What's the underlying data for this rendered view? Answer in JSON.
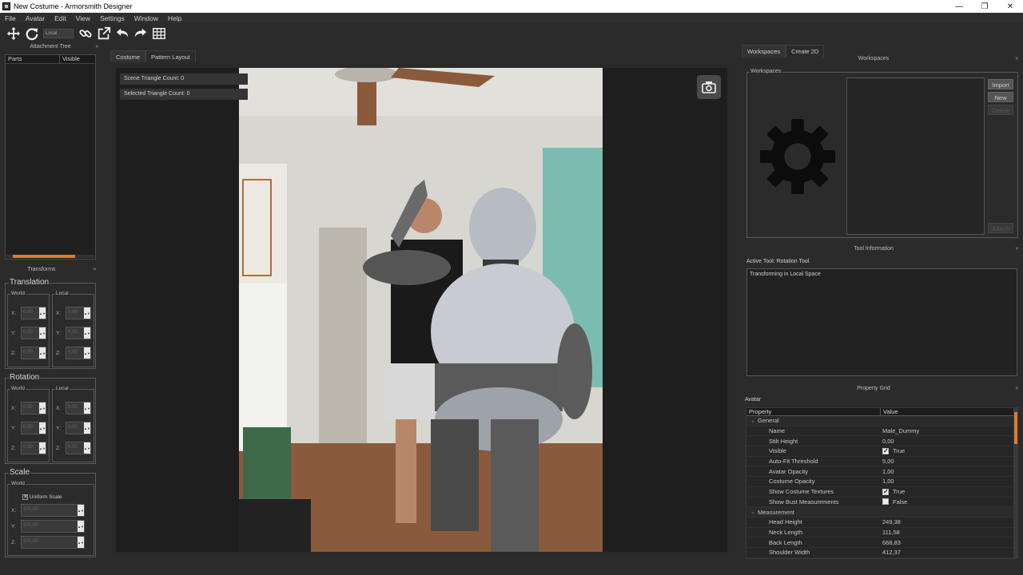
{
  "window": {
    "title": "New Costume - Armorsmith Designer",
    "minimize": "—",
    "restore": "❐",
    "close": "✕"
  },
  "menu": [
    "File",
    "Avatar",
    "Edit",
    "View",
    "Settings",
    "Window",
    "Help"
  ],
  "toolbar": {
    "space_mode": "Local",
    "icons": [
      "move-icon",
      "rotate-icon",
      "link-icon",
      "external-icon",
      "undo-icon",
      "redo-icon",
      "grid-icon"
    ]
  },
  "attachment_tree": {
    "title": "Attachment Tree",
    "columns": [
      "Parts",
      "Visible"
    ]
  },
  "transforms": {
    "title": "Transforms",
    "translation": {
      "label": "Translation",
      "world": "World",
      "local": "Local"
    },
    "rotation": {
      "label": "Rotation",
      "world": "World",
      "local": "Local"
    },
    "scale": {
      "label": "Scale",
      "world": "World",
      "uniform": "Uniform Scale",
      "uniform_checked": true,
      "x": "100,00",
      "y": "100,00",
      "z": "100,00"
    },
    "axes": [
      "X:",
      "Y:",
      "Z:"
    ],
    "placeholder": "0,00"
  },
  "viewport": {
    "tabs": [
      "Costume",
      "Pattern Layout"
    ],
    "scene_triangle": "Scene Triangle Count: 0",
    "selected_triangle": "Selected Triangle Count: 0"
  },
  "workspaces": {
    "tabs": [
      "Workspaces",
      "Create 2D"
    ],
    "panel_title": "Workspaces",
    "group_label": "Workspaces",
    "buttons": {
      "import": "Import",
      "new": "New",
      "delete": "Delete",
      "attach": "Attach"
    }
  },
  "tool_information": {
    "title": "Tool Information",
    "active_tool": "Active Tool: Rotation Tool",
    "description": "Transforming in Local Space"
  },
  "property_grid": {
    "title": "Property Grid",
    "object": "Avatar",
    "columns": [
      "Property",
      "Value"
    ],
    "rows": [
      {
        "name": "General",
        "value": "",
        "category": true
      },
      {
        "name": "Name",
        "value": "Male_Dummy"
      },
      {
        "name": "Stilt Height",
        "value": "0,00"
      },
      {
        "name": "Visible",
        "value": "True",
        "check": true
      },
      {
        "name": "Auto-Fit Threshold",
        "value": "5,00"
      },
      {
        "name": "Avatar Opacity",
        "value": "1,00"
      },
      {
        "name": "Costume Opacity",
        "value": "1,00"
      },
      {
        "name": "Show Costume Textures",
        "value": "True",
        "check": true
      },
      {
        "name": "Show Bust Measurements",
        "value": "False",
        "check": false
      },
      {
        "name": "Measurement",
        "value": "",
        "category": true
      },
      {
        "name": "Head Height",
        "value": "249,38"
      },
      {
        "name": "Neck Length",
        "value": "111,58"
      },
      {
        "name": "Back Length",
        "value": "668,83"
      },
      {
        "name": "Shoulder Width",
        "value": "412,37"
      }
    ]
  },
  "colors": {
    "accent": "#e07a2c",
    "panel": "#2b2b2b",
    "dark": "#1e1e1e"
  }
}
